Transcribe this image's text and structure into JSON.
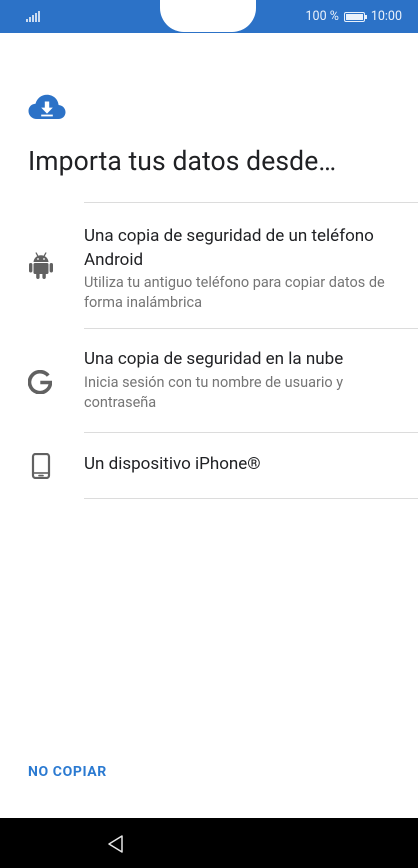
{
  "status_bar": {
    "battery_text": "100 %",
    "time": "10:00"
  },
  "page": {
    "title": "Importa tus datos desde…",
    "header_icon": "cloud-download-icon",
    "accent_color": "#2c72c7"
  },
  "options": [
    {
      "icon": "android-icon",
      "title": "Una copia de seguridad de un teléfono Android",
      "description": "Utiliza tu antiguo teléfono para copiar datos de forma inalámbrica"
    },
    {
      "icon": "google-icon",
      "title": "Una copia de seguridad en la nube",
      "description": "Inicia sesión con tu nombre de usuario y contraseña"
    },
    {
      "icon": "smartphone-icon",
      "title": "Un dispositivo iPhone®"
    }
  ],
  "footer": {
    "skip_label": "NO COPIAR"
  },
  "nav_bar": {
    "back_icon": "back-triangle-icon"
  }
}
